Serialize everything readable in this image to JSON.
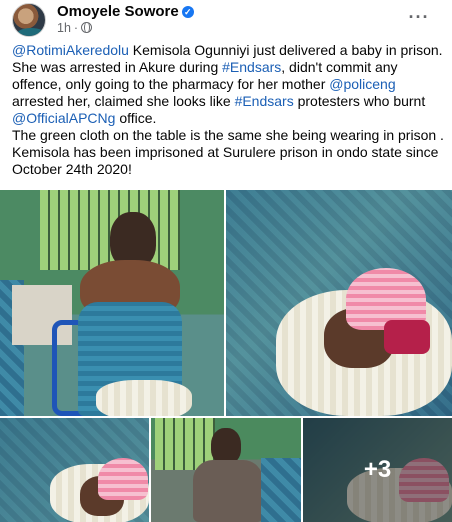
{
  "post": {
    "author": "Omoyele Sowore",
    "time": "1h",
    "separator": "·",
    "more_label": "···",
    "text": {
      "line1_mention": "@RotimiAkeredolu",
      "line1_rest": " Kemisola Ogunniyi just delivered a baby in prison. She was arrested in Akure during ",
      "hashtag1": "#Endsars",
      "line2_rest": ", didn't commit any offence, only going to the pharmacy for her mother ",
      "mention2": "@policeng",
      "line3_rest": " arrested her, claimed she looks like ",
      "hashtag2": "#Endsars",
      "line4_rest": " protesters who burnt ",
      "mention3": "@OfficialAPCNg",
      "line5_rest": " office.",
      "para2": "The green cloth on the table is the same she being wearing in prison . Kemisola has been imprisoned at Surulere prison in ondo state since October 24th 2020!"
    },
    "photos": {
      "extra_count": "+3"
    }
  },
  "icons": {
    "verified": "verified-badge-icon",
    "audience": "globe-icon",
    "more": "more-options-icon"
  },
  "colors": {
    "link": "#1b5fb5",
    "verified": "#1877f2",
    "meta": "#65676b"
  }
}
